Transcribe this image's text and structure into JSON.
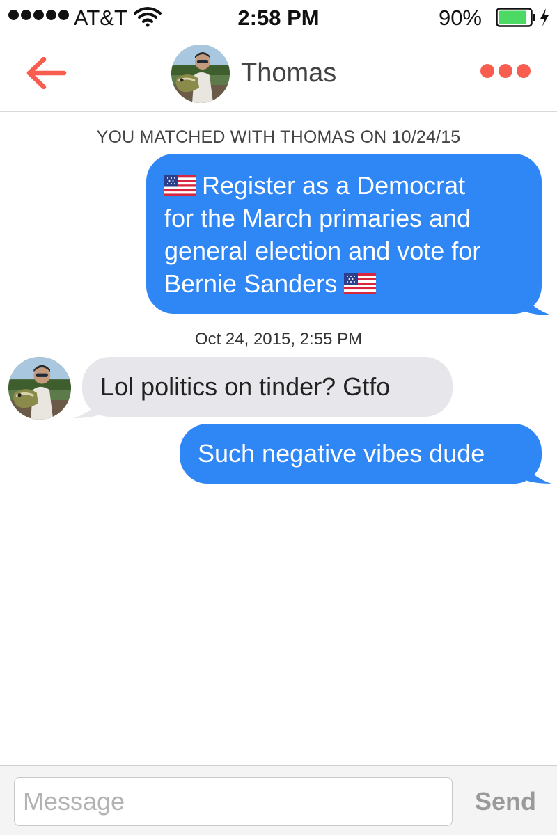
{
  "status_bar": {
    "carrier": "AT&T",
    "time": "2:58 PM",
    "battery_percent": "90%",
    "battery_level": 0.9,
    "signal_bars": 5
  },
  "header": {
    "contact_name": "Thomas",
    "back_icon": "back-arrow-icon",
    "more_icon": "more-dots-icon",
    "accent_color": "#f95d4f"
  },
  "chat": {
    "match_banner": "YOU MATCHED WITH THOMAS ON 10/24/15",
    "messages": [
      {
        "direction": "outgoing",
        "text": "Register as a Democrat for the March primaries and general election and vote for Bernie Sanders",
        "lines": [
          "Register as a Democrat",
          "for the March primaries and",
          "general election and vote for",
          "Bernie Sanders"
        ],
        "leading_icon": "us-flag-icon",
        "trailing_icon": "us-flag-icon"
      },
      {
        "direction": "incoming",
        "text": "Lol politics on tinder? Gtfo",
        "timestamp": "Oct 24, 2015, 2:55 PM"
      },
      {
        "direction": "outgoing",
        "text": "Such negative vibes dude"
      }
    ],
    "outgoing_color": "#2f86f5",
    "incoming_color": "#e6e6eb"
  },
  "composer": {
    "placeholder": "Message",
    "value": "",
    "send_label": "Send"
  }
}
